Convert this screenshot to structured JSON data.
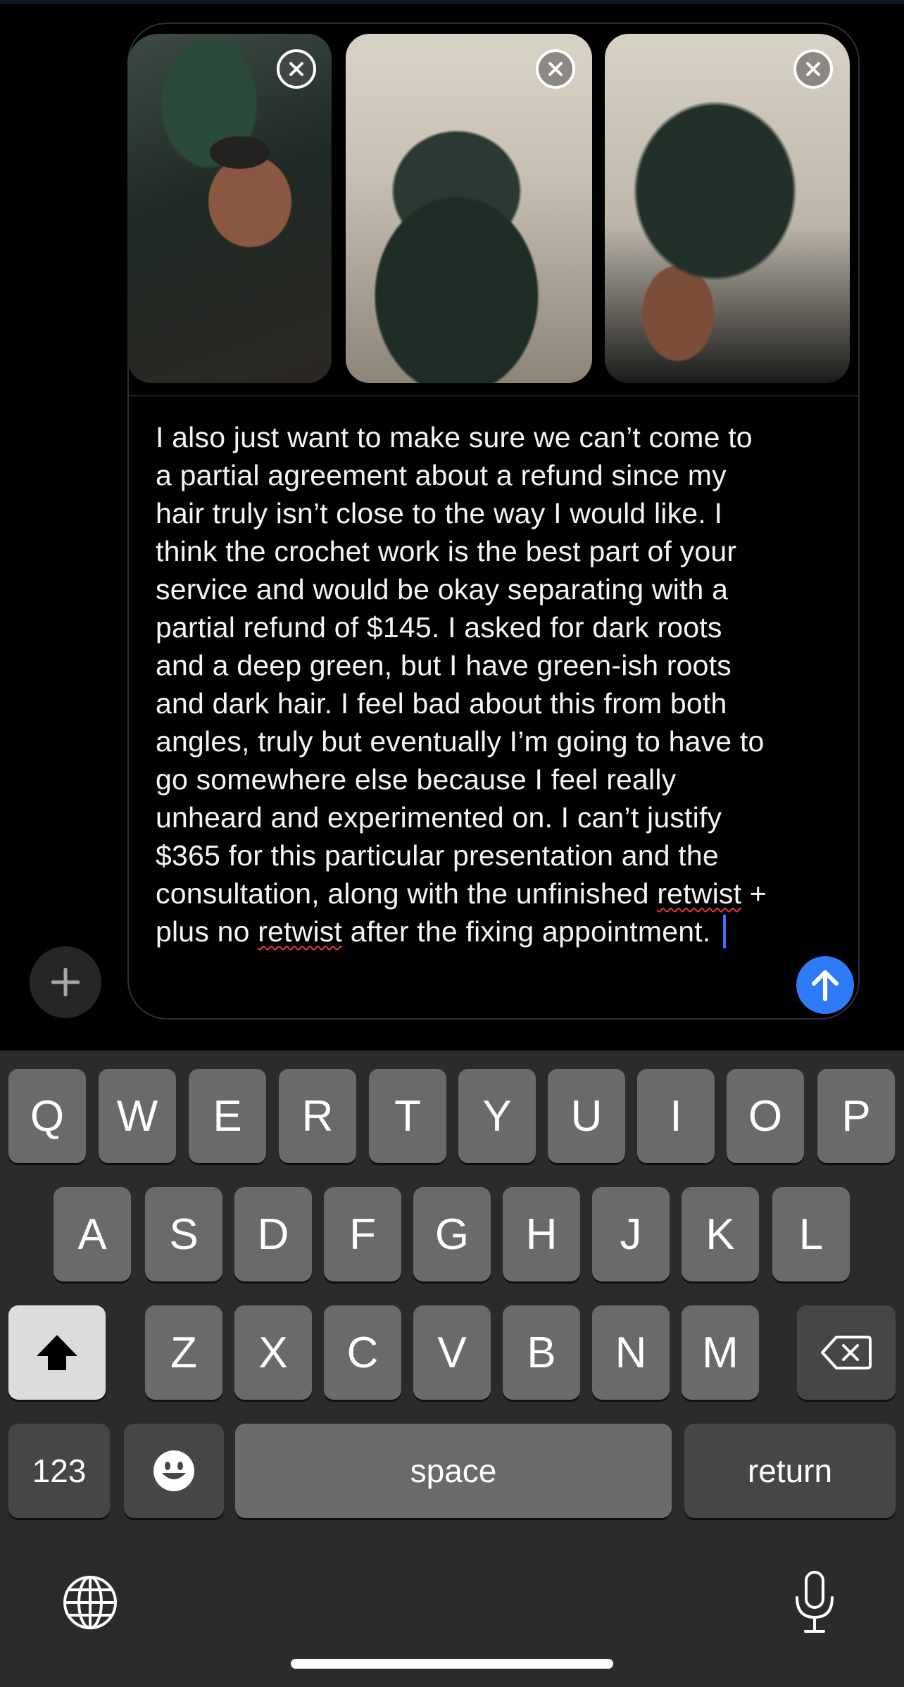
{
  "compose": {
    "attachments": [
      {
        "name": "photo-1",
        "remove_icon": "close-icon"
      },
      {
        "name": "photo-2",
        "remove_icon": "close-icon"
      },
      {
        "name": "photo-3",
        "remove_icon": "close-icon"
      }
    ],
    "message_parts": [
      "I also just want to make sure we can’t come to a partial agreement about a refund since my hair truly isn’t close to the way I would like. I think the crochet work is the best part of your service and would be okay separating with a partial refund of $145. I asked for dark roots and a deep green, but I have green-ish roots and dark hair. I feel bad about this from both angles, truly but eventually I’m going to have to go somewhere else because I feel really unheard and experimented on. I can’t justify $365 for this particular presentation and the consultation, along with the unfinished ",
      "retwist",
      " + plus no ",
      "retwist",
      " after the fixing appointment. "
    ],
    "send_icon": "arrow-up-icon",
    "add_icon": "plus-icon"
  },
  "keyboard": {
    "row1": [
      "Q",
      "W",
      "E",
      "R",
      "T",
      "Y",
      "U",
      "I",
      "O",
      "P"
    ],
    "row2": [
      "A",
      "S",
      "D",
      "F",
      "G",
      "H",
      "J",
      "K",
      "L"
    ],
    "row3": [
      "Z",
      "X",
      "C",
      "V",
      "B",
      "N",
      "M"
    ],
    "shift_icon": "shift-icon",
    "delete_icon": "backspace-icon",
    "numbers_label": "123",
    "emoji_icon": "emoji-icon",
    "space_label": "space",
    "return_label": "return",
    "globe_icon": "globe-icon",
    "mic_icon": "microphone-icon"
  },
  "colors": {
    "send_button": "#2f7bf6",
    "caret": "#3f6bff",
    "spellcheck_underline": "#e0383f",
    "keyboard_bg": "#2b2b2b"
  }
}
